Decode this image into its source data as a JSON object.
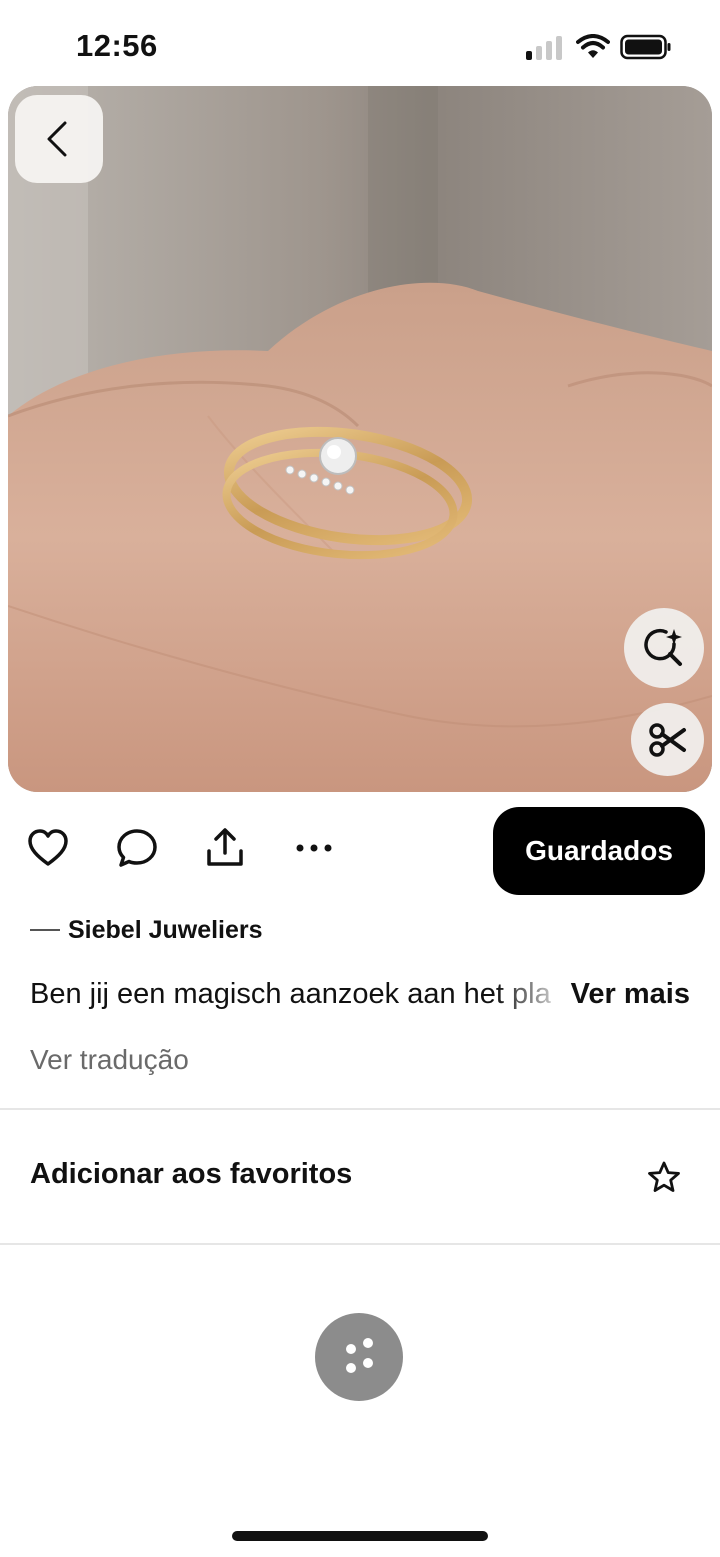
{
  "status_bar": {
    "time": "12:56"
  },
  "pin": {
    "image_alt": "Close-up of a hand wearing a gold solitaire diamond ring and a thin gold band set with small diamonds",
    "icons": {
      "back": "chevron-left-icon",
      "visual_search": "lens-sparkle-icon",
      "cutout": "scissors-icon"
    }
  },
  "actions": {
    "icons": [
      "heart-icon",
      "comment-icon",
      "share-icon",
      "more-icon"
    ],
    "save_label": "Guardados"
  },
  "creator": {
    "name": "Siebel Juweliers"
  },
  "description": {
    "text": "Ben jij een magisch aanzoek aan het pla",
    "more_label": "Ver mais",
    "translate_label": "Ver tradução"
  },
  "favorites": {
    "label": "Adicionar aos favoritos",
    "icon": "star-outline-icon"
  },
  "colors": {
    "primary_button": "#000000",
    "secondary_text": "#6a6a6a",
    "loader": "#8c8c8c"
  }
}
